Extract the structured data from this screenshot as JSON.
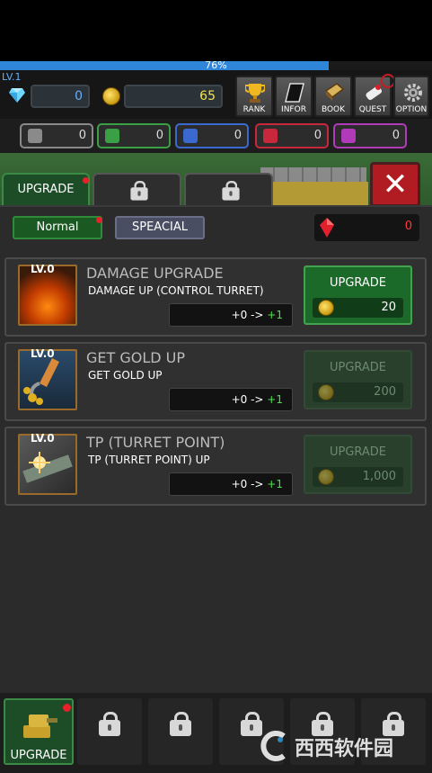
{
  "header": {
    "xp_percent": 76,
    "xp_label": "76%",
    "level": "LV.1",
    "gems": "0",
    "gold": "65"
  },
  "top_buttons": [
    {
      "label": "RANK",
      "icon": "trophy-icon"
    },
    {
      "label": "INFOR",
      "icon": "info-card-icon"
    },
    {
      "label": "BOOK",
      "icon": "book-icon"
    },
    {
      "label": "QUEST",
      "icon": "quest-scroll-icon"
    },
    {
      "label": "OPTION",
      "icon": "gear-icon"
    }
  ],
  "materials": [
    {
      "value": "0",
      "color": "#8a8a8a",
      "name": "gray-material"
    },
    {
      "value": "0",
      "color": "#3aa046",
      "name": "green-material"
    },
    {
      "value": "0",
      "color": "#3a6ad0",
      "name": "blue-material"
    },
    {
      "value": "0",
      "color": "#c8283c",
      "name": "red-material"
    },
    {
      "value": "0",
      "color": "#b03ab8",
      "name": "purple-material"
    }
  ],
  "tabs": {
    "active_label": "UPGRADE"
  },
  "modes": {
    "normal": "Normal",
    "special": "SPEACIAL"
  },
  "red_gems": "0",
  "upgrades": [
    {
      "level": "LV.0",
      "title": "DAMAGE UPGRADE",
      "desc": "DAMAGE UP (CONTROL TURRET)",
      "from": "+0 ->",
      "to": "+1",
      "button": "UPGRADE",
      "price": "20",
      "enabled": true
    },
    {
      "level": "LV.0",
      "title": "GET GOLD UP",
      "desc": "GET GOLD UP",
      "from": "+0 ->",
      "to": "+1",
      "button": "UPGRADE",
      "price": "200",
      "enabled": false
    },
    {
      "level": "LV.0",
      "title": "TP (TURRET POINT)",
      "desc": "TP (TURRET POINT) UP",
      "from": "+0 ->",
      "to": "+1",
      "button": "UPGRADE",
      "price": "1,000",
      "enabled": false
    }
  ],
  "bottom_nav": {
    "active_label": "UPGRADE"
  },
  "watermark": "西西软件园"
}
